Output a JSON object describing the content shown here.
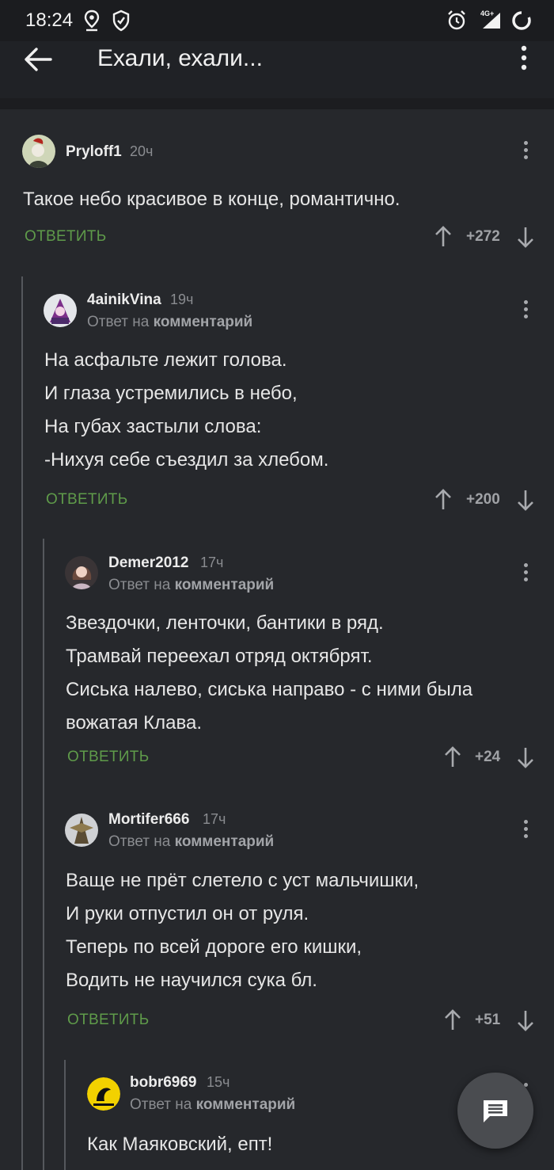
{
  "status": {
    "time": "18:24",
    "network": "4G+"
  },
  "header": {
    "title": "Ехали, ехали..."
  },
  "comments": [
    {
      "username": "Pryloff1",
      "time": "20ч",
      "reply_prefix": "",
      "reply_target": "",
      "lines": [
        "Такое небо красивое в конце, романтично."
      ],
      "reply_label": "ОТВЕТИТЬ",
      "score": "+272"
    },
    {
      "username": "4ainikVina",
      "time": "19ч",
      "reply_prefix": "Ответ на",
      "reply_target": "комментарий",
      "lines": [
        "На асфальте лежит голова.",
        "И глаза устремились в небо,",
        "На губах застыли слова:",
        "-Нихуя себе съездил за хлебом."
      ],
      "reply_label": "ОТВЕТИТЬ",
      "score": "+200"
    },
    {
      "username": "Demer2012",
      "time": "17ч",
      "reply_prefix": "Ответ на",
      "reply_target": "комментарий",
      "lines": [
        "Звездочки, ленточки, бантики в ряд.",
        "Трамвай переехал отряд октябрят.",
        "Сиська налево, сиська направо - с ними была",
        "вожатая Клава."
      ],
      "reply_label": "ОТВЕТИТЬ",
      "score": "+24"
    },
    {
      "username": "Mortifer666",
      "time": "17ч",
      "reply_prefix": "Ответ на",
      "reply_target": "комментарий",
      "lines": [
        "Ваще не прёт слетело с уст мальчишки,",
        "И руки отпустил он от руля.",
        "Теперь по всей дороге его кишки,",
        "Водить не научился сука бл."
      ],
      "reply_label": "ОТВЕТИТЬ",
      "score": "+51"
    },
    {
      "username": "bobr6969",
      "time": "15ч",
      "reply_prefix": "Ответ на",
      "reply_target": "комментарий",
      "lines": [
        "Как Маяковский, епт!"
      ],
      "reply_label": "",
      "score": ""
    }
  ]
}
